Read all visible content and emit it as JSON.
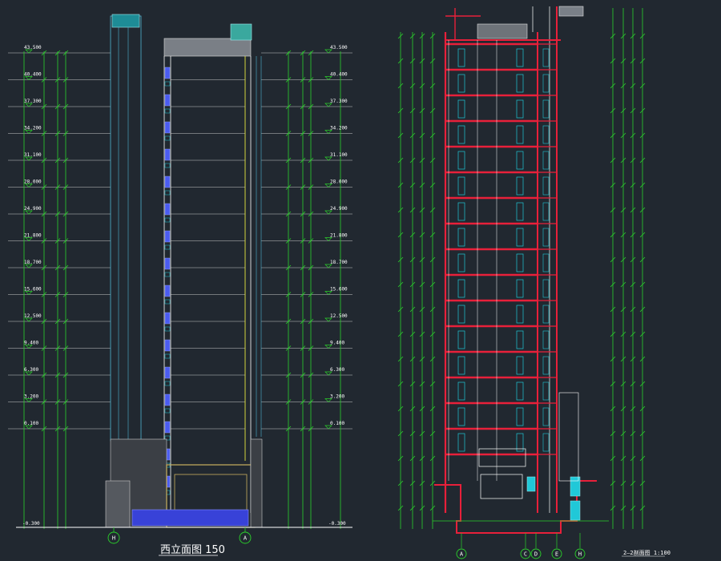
{
  "elevation": {
    "title": "西立面图 150",
    "axis_left": "H",
    "axis_right": "A",
    "bottom_left_level": "-0.300",
    "bottom_right_level": "-0.300",
    "floor_levels": [
      "43.500",
      "40.400",
      "37.300",
      "34.200",
      "31.100",
      "28.000",
      "24.900",
      "21.800",
      "18.700",
      "15.600",
      "12.500",
      "9.400",
      "6.300",
      "3.200",
      "0.100"
    ]
  },
  "section": {
    "title": "2—2剖面图 1:100",
    "axis_labels": [
      "A",
      "C",
      "D",
      "E",
      "H"
    ]
  },
  "colors": {
    "background": "#212830",
    "dim_green": "#2bd12b",
    "building_white": "#ffffff",
    "column_cyan": "#20c8d8",
    "slab_red": "#e8203a",
    "accent_blue": "#4b5cf0",
    "text_yellow": "#ffff40"
  }
}
